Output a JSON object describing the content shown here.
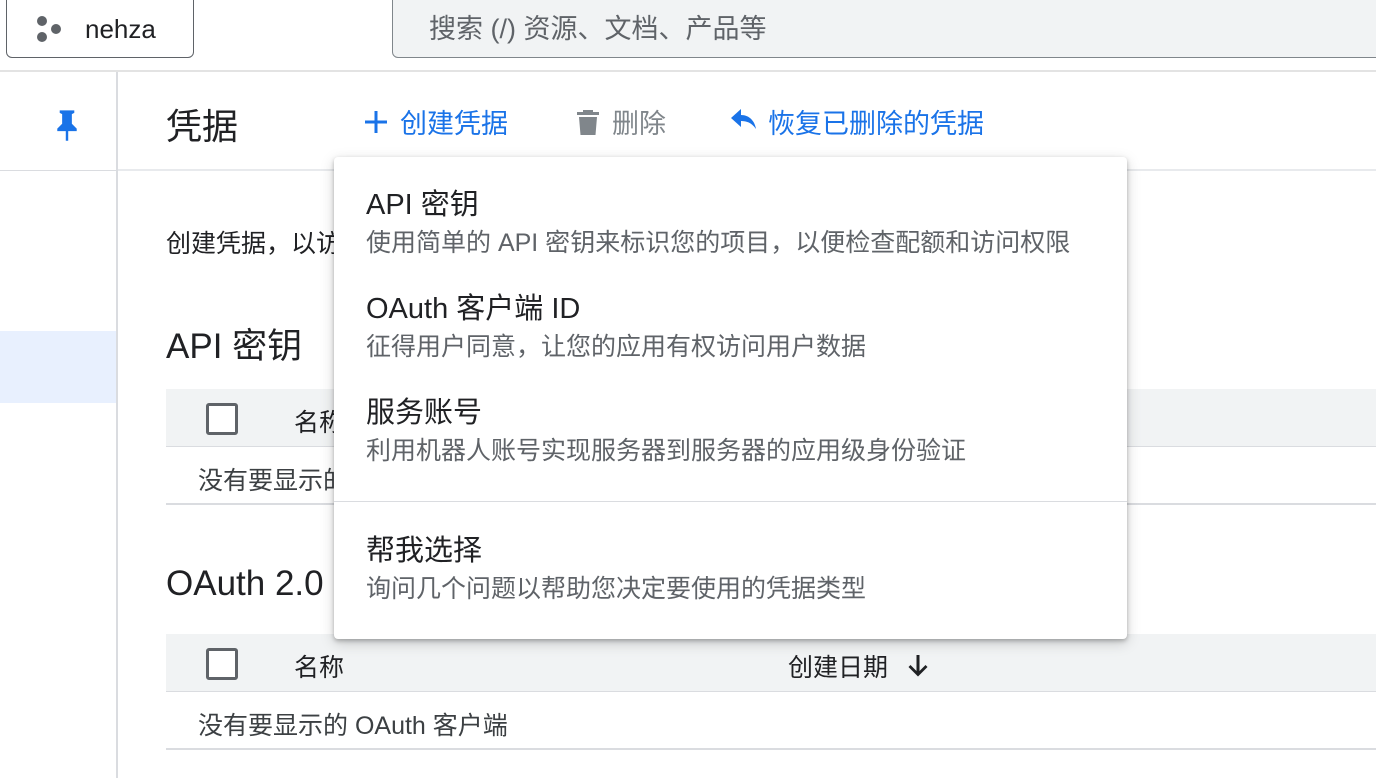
{
  "topbar": {
    "project_name": "nehza",
    "search_placeholder": "搜索 (/) 资源、文档、产品等"
  },
  "header": {
    "title": "凭据",
    "actions": {
      "create": "创建凭据",
      "delete": "删除",
      "restore": "恢复已删除的凭据"
    }
  },
  "content": {
    "intro": "创建凭据，以访",
    "api_section": {
      "title": "API 密钥",
      "col_name": "名称",
      "empty": "没有要显示的"
    },
    "oauth_section": {
      "title": "OAuth 2.0 ",
      "col_name": "名称",
      "col_date": "创建日期",
      "empty": "没有要显示的 OAuth 客户端"
    }
  },
  "menu": {
    "items": [
      {
        "title": "API 密钥",
        "desc": "使用简单的 API 密钥来标识您的项目，以便检查配额和访问权限"
      },
      {
        "title": "OAuth 客户端 ID",
        "desc": "征得用户同意，让您的应用有权访问用户数据"
      },
      {
        "title": "服务账号",
        "desc": "利用机器人账号实现服务器到服务器的应用级身份验证"
      },
      {
        "title": "帮我选择",
        "desc": "询问几个问题以帮助您决定要使用的凭据类型"
      }
    ]
  },
  "colors": {
    "accent": "#1a73e8",
    "muted": "#80868b",
    "active_bg": "#e8f0fe"
  },
  "icons": [
    "project-hexagon-icon",
    "pin-icon",
    "plus-icon",
    "trash-icon",
    "undo-icon",
    "arrow-down-icon"
  ]
}
